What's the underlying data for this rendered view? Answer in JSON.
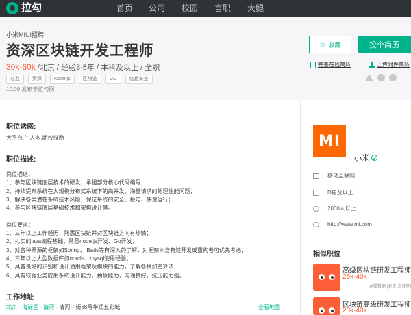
{
  "nav": {
    "logo_text": "拉勾",
    "items": [
      "首页",
      "公司",
      "校园",
      "言职",
      "大鲲"
    ]
  },
  "job": {
    "company_line": "小米MIUI招聘",
    "title": "资深区块链开发工程师",
    "salary": "30k-60k",
    "meta": " /北京 / 经验3-5年 / 本科及以上 / 全职",
    "tags": [
      "总监",
      "资深",
      "Node.js",
      "区块链",
      "GO",
      "信息安全"
    ],
    "publish": "10:09  发布于拉勾网"
  },
  "actions": {
    "save_label": "收藏",
    "apply_label": "投个简历",
    "online_resume_label": "完善在线简历",
    "upload_resume_label": "上传附件简历"
  },
  "content": {
    "perks_title": "职位诱惑:",
    "perks_text": "大平台,牛人多,期权鼓励",
    "desc_title": "职位描述:",
    "desc_lines": [
      "岗位描述：",
      "1、参与区块链底层技术的研发，承担部分核心代码编写；",
      "2、持续提升系统在大规模分布式系统下的高并发、海量请求的处理性能问题；",
      "3、解决各类潜在系统技术风险，保证系统的安全、稳定、快速运行；",
      "4、参与区块链底层基础技术和架构设计等。",
      "",
      "岗位要求：",
      "1、三年以上工作经历，熟悉区块链并对区块链方向有热情；",
      "2、扎实的java编程基础，熟悉node.js开发、Go开发；",
      "3、对各种开源的框架如Spring、iBatis等有深入的了解，对框架本身有过开发或重构者可优先考虑；",
      "4、三年以上大型数据库如oracle、mysql使用经验；",
      "5、具备良好的识别和设计通用框架及模块的能力，了解各种加密算法；",
      "6、具有较强业务应用系统设计能力，抽象能力，沟通良好，抗压能力强。"
    ],
    "address_title": "工作地址",
    "address_city": "北京",
    "address_district": "海淀区",
    "address_area": "清河",
    "address_detail": "清河中街68号华润五彩城",
    "map_link": "查看地图"
  },
  "company": {
    "name": "小米",
    "logo_text": "MI",
    "industry": "移动互联网",
    "stage": "D轮及以上",
    "size": "2000人以上",
    "website": "http://www.mi.com"
  },
  "related": {
    "title": "相似职位",
    "jobs": [
      {
        "title": "高级区块链研发工程师",
        "salary": "25k-40k",
        "company": "龙猫数据 [北京·海淀区]"
      },
      {
        "title": "区块链高级研发工程师",
        "salary": "20k-40k",
        "company": ""
      }
    ]
  },
  "colors": {
    "accent": "#00b38a",
    "salary": "#fd5f39",
    "nav_bg": "#2f3336",
    "mi_orange": "#ff6700"
  }
}
